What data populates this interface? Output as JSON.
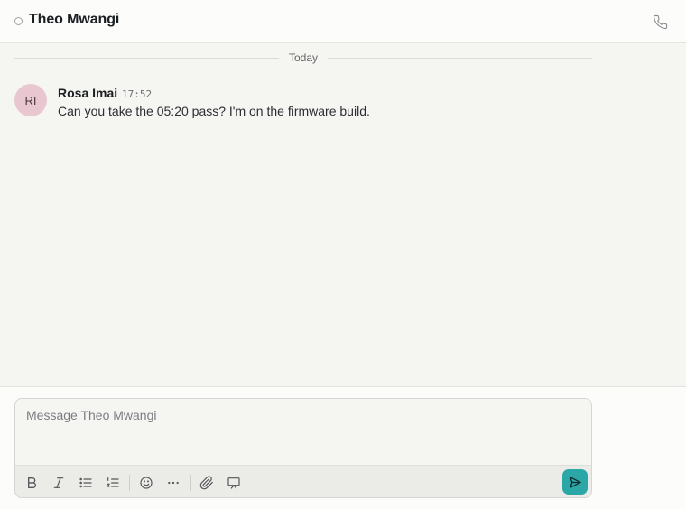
{
  "header": {
    "title": "Theo Mwangi",
    "presence": "offline",
    "call_icon": "phone-icon"
  },
  "divider": {
    "label": "Today"
  },
  "messages": [
    {
      "author": "Rosa Imai",
      "initials": "RI",
      "time": "17:52",
      "text": "Can you take the 05:20 pass? I'm on the firmware build.",
      "avatar_color": "#e8c7d1"
    }
  ],
  "composer": {
    "placeholder": "Message Theo Mwangi",
    "value": "",
    "toolbar": [
      "bold-icon",
      "italic-icon",
      "bullet-list-icon",
      "numbered-list-icon",
      "emoji-icon",
      "more-icon",
      "attach-icon",
      "presentation-icon"
    ],
    "send_icon": "send-icon",
    "send_color": "#2ba7a7"
  }
}
